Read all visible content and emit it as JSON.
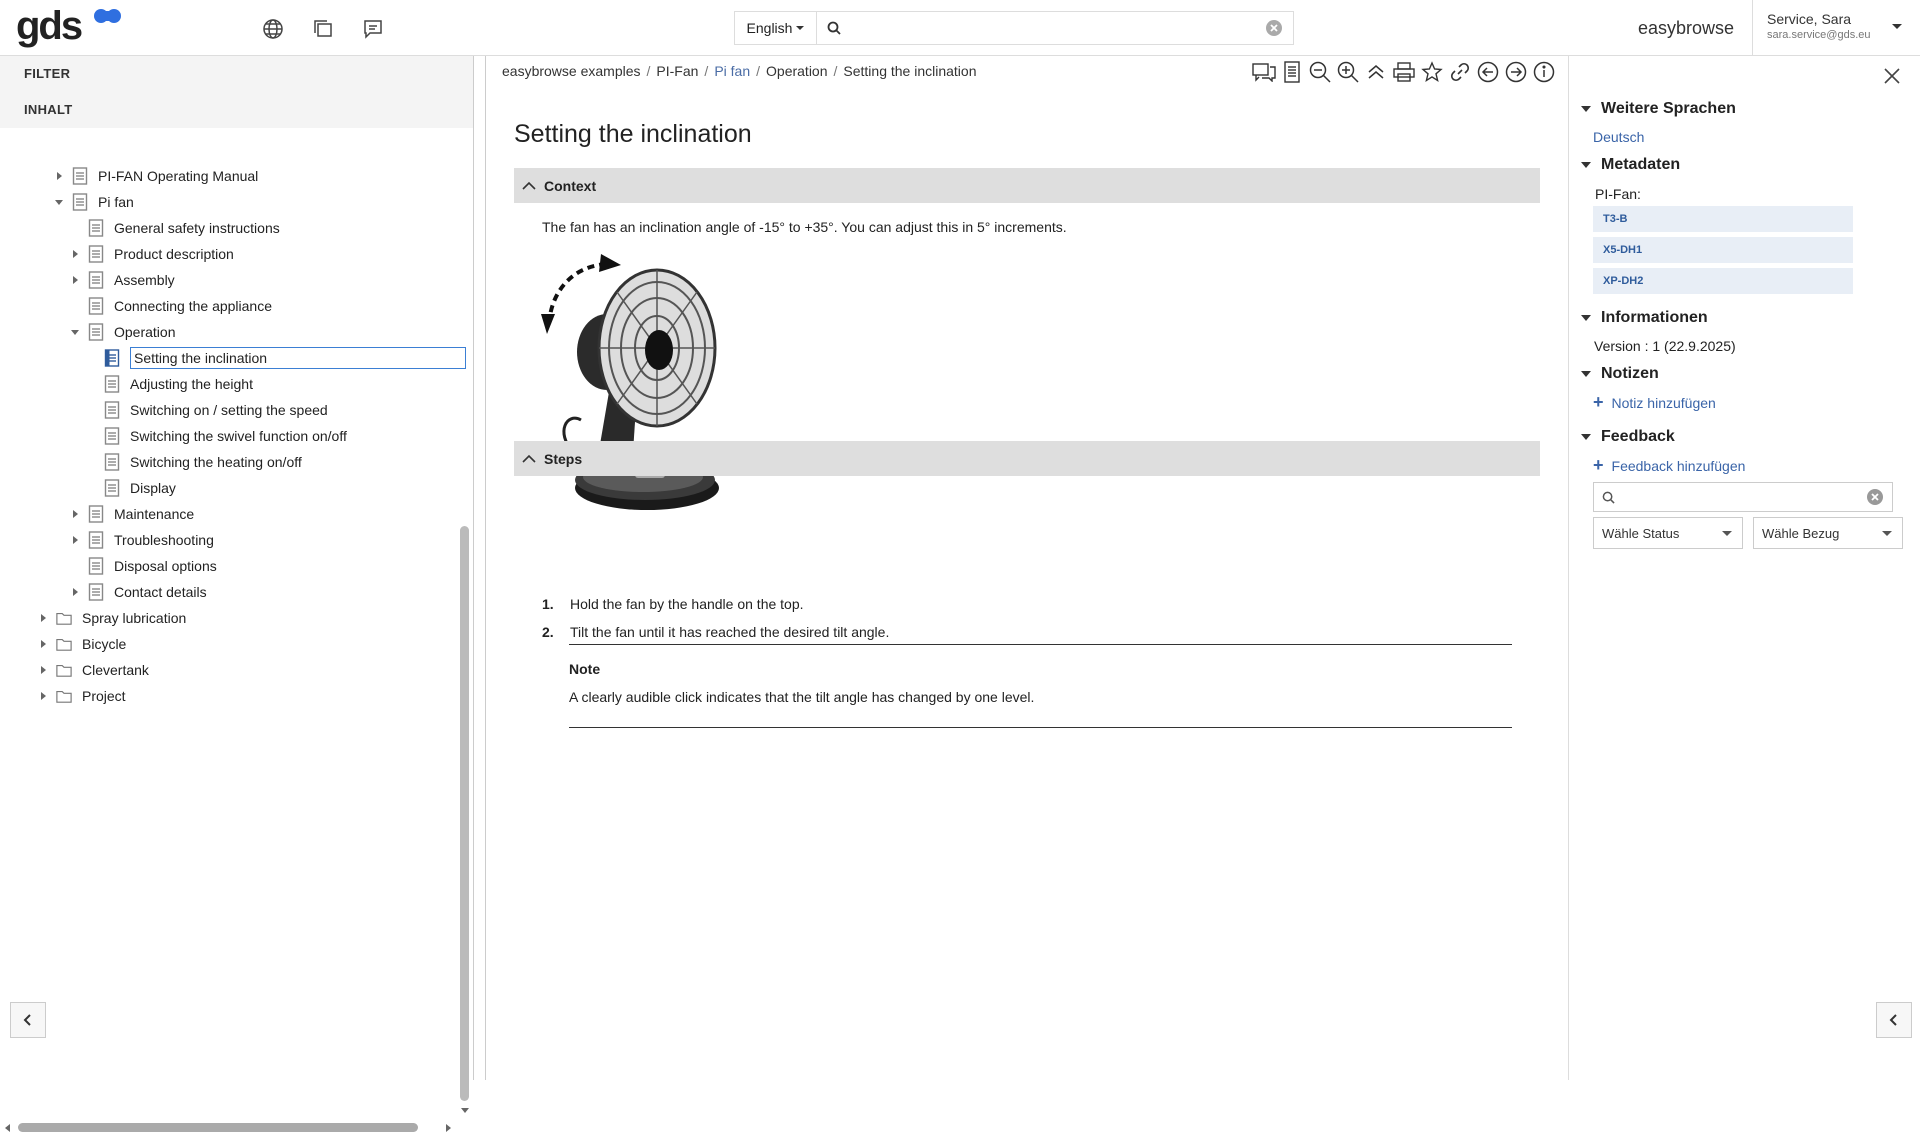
{
  "header": {
    "logo_text": "gds",
    "language": "English",
    "search_placeholder": "",
    "brand": "easybrowse",
    "user_name": "Service, Sara",
    "user_email": "sara.service@gds.eu",
    "icons": [
      "globe-icon",
      "windows-icon",
      "comment-icon"
    ]
  },
  "left_panel": {
    "filter_label": "FILTER",
    "content_label": "INHALT",
    "tree": [
      {
        "label": "PI-FAN Operating Manual",
        "level": 1,
        "arrow": "right",
        "icon": "document"
      },
      {
        "label": "Pi fan",
        "level": 1,
        "arrow": "down",
        "icon": "document"
      },
      {
        "label": "General safety instructions",
        "level": 2,
        "arrow": "none",
        "icon": "document"
      },
      {
        "label": "Product description",
        "level": 2,
        "arrow": "right",
        "icon": "document"
      },
      {
        "label": "Assembly",
        "level": 2,
        "arrow": "right",
        "icon": "document"
      },
      {
        "label": "Connecting the appliance",
        "level": 2,
        "arrow": "none",
        "icon": "document"
      },
      {
        "label": "Operation",
        "level": 2,
        "arrow": "down",
        "icon": "document"
      },
      {
        "label": "Setting the inclination",
        "level": 3,
        "arrow": "none",
        "icon": "document-selected",
        "selected": true
      },
      {
        "label": "Adjusting the height",
        "level": 3,
        "arrow": "none",
        "icon": "document"
      },
      {
        "label": "Switching on / setting the speed",
        "level": 3,
        "arrow": "none",
        "icon": "document"
      },
      {
        "label": "Switching the swivel function on/off",
        "level": 3,
        "arrow": "none",
        "icon": "document"
      },
      {
        "label": "Switching the heating on/off",
        "level": 3,
        "arrow": "none",
        "icon": "document"
      },
      {
        "label": "Display",
        "level": 3,
        "arrow": "none",
        "icon": "document"
      },
      {
        "label": "Maintenance",
        "level": 2,
        "arrow": "right",
        "icon": "document"
      },
      {
        "label": "Troubleshooting",
        "level": 2,
        "arrow": "right",
        "icon": "document"
      },
      {
        "label": "Disposal options",
        "level": 2,
        "arrow": "none",
        "icon": "document"
      },
      {
        "label": "Contact details",
        "level": 2,
        "arrow": "right",
        "icon": "document"
      },
      {
        "label": "Spray lubrication",
        "level": 0,
        "arrow": "right",
        "icon": "folder"
      },
      {
        "label": "Bicycle",
        "level": 0,
        "arrow": "right",
        "icon": "folder"
      },
      {
        "label": "Clevertank",
        "level": 0,
        "arrow": "right",
        "icon": "folder"
      },
      {
        "label": "Project",
        "level": 0,
        "arrow": "right",
        "icon": "folder"
      }
    ]
  },
  "breadcrumb": [
    "easybrowse examples",
    "PI-Fan",
    "Pi fan",
    "Operation",
    "Setting the inclination"
  ],
  "toolbar_icons": [
    "comments-icon",
    "document-list-icon",
    "zoom-out-icon",
    "zoom-in-icon",
    "collapse-up-icon",
    "print-icon",
    "favorite-star-icon",
    "link-icon",
    "previous-icon",
    "next-icon",
    "info-icon"
  ],
  "content": {
    "title": "Setting the inclination",
    "context_heading": "Context",
    "context_text": "The fan has an inclination angle of -15° to +35°. You can adjust this in 5° increments.",
    "steps_heading": "Steps",
    "steps": [
      {
        "num": "1.",
        "text": "Hold the fan by the handle on the top."
      },
      {
        "num": "2.",
        "text": "Tilt the fan until it has reached the desired tilt angle."
      }
    ],
    "note_title": "Note",
    "note_text": "A clearly audible click indicates that the tilt angle has changed by one level."
  },
  "right_panel": {
    "languages_heading": "Weitere Sprachen",
    "language_link": "Deutsch",
    "metadata_heading": "Metadaten",
    "metadata_label": "PI-Fan:",
    "tags": [
      "T3-B",
      "X5-DH1",
      "XP-DH2"
    ],
    "info_heading": "Informationen",
    "version_text": "Version : 1 (22.9.2025)",
    "notes_heading": "Notizen",
    "add_note": "Notiz hinzufügen",
    "feedback_heading": "Feedback",
    "add_feedback": "Feedback hinzufügen",
    "status_select": "Wähle Status",
    "reference_select": "Wähle Bezug"
  }
}
